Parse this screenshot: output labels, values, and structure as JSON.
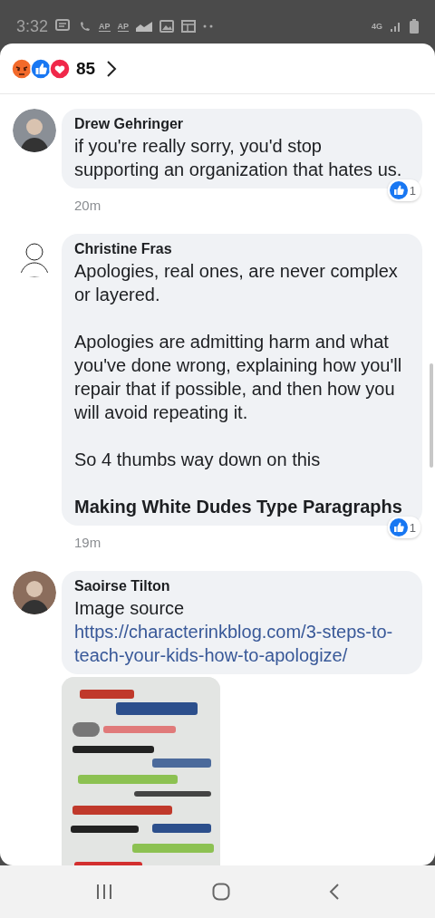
{
  "status_bar": {
    "time": "3:32",
    "badges": [
      "AP",
      "AP"
    ],
    "network": "4G"
  },
  "reactions": {
    "count": "85"
  },
  "comments": [
    {
      "author": "Drew Gehringer",
      "paragraphs": [
        {
          "text": "if you're really sorry, you'd stop supporting an organization that hates us.",
          "bold": false
        }
      ],
      "time": "20m",
      "likes": "1"
    },
    {
      "author": "Christine Fras",
      "paragraphs": [
        {
          "text": "Apologies, real ones, are never complex or layered.",
          "bold": false
        },
        {
          "text": "Apologies are admitting harm and what you've done wrong, explaining how you'll repair that if possible, and then how you will avoid repeating it.",
          "bold": false
        },
        {
          "text": "So 4 thumbs way down on this",
          "bold": false
        },
        {
          "text": "Making White Dudes Type Paragraphs",
          "bold": true
        }
      ],
      "time": "19m",
      "likes": "1"
    },
    {
      "author": "Saoirse Tilton",
      "paragraphs": [
        {
          "text": "Image source",
          "bold": false
        }
      ],
      "link": "https://characterinkblog.com/3-steps-to-teach-your-kids-how-to-apologize/",
      "attachment": {
        "kind": "picture"
      }
    }
  ]
}
